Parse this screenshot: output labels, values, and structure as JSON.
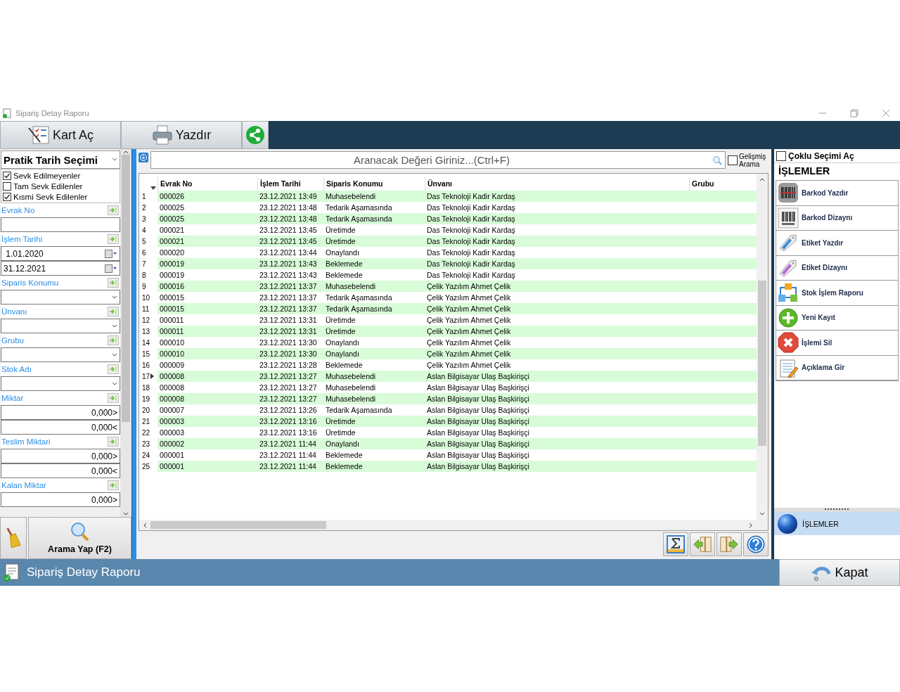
{
  "window": {
    "title": "Sipariş Detay Raporu"
  },
  "toolbar": [
    {
      "label": "Kart Aç",
      "kind": "card"
    },
    {
      "label": "Yazdır",
      "kind": "print"
    },
    {
      "kind": "share"
    }
  ],
  "filters": {
    "date_preset": "Pratik Tarih Seçimi",
    "checks": [
      {
        "label": "Sevk Edilmeyenler",
        "checked": true
      },
      {
        "label": "Tam Sevk Edilenler",
        "checked": false
      },
      {
        "label": "Kısmi Sevk Edilenler",
        "checked": true
      }
    ],
    "fields": [
      {
        "label": "Evrak No",
        "kind": "text"
      },
      {
        "label": "İşlem Tarihi",
        "kind": "dates",
        "values": [
          " 1.01.2020",
          "31.12.2021"
        ]
      },
      {
        "label": "Siparis Konumu",
        "kind": "combo"
      },
      {
        "label": "Ünvanı",
        "kind": "combo"
      },
      {
        "label": "Grubu",
        "kind": "combo"
      },
      {
        "label": "Stok Adı",
        "kind": "combo"
      },
      {
        "label": "Miktar",
        "kind": "range",
        "values": [
          "0,000>",
          "0,000<"
        ]
      },
      {
        "label": "Teslim Miktari",
        "kind": "range",
        "values": [
          "0,000>",
          "0,000<"
        ]
      },
      {
        "label": "Kalan Miktar",
        "kind": "range",
        "values": [
          "0,000>"
        ]
      }
    ],
    "search_button": "Arama Yap (F2)"
  },
  "search": {
    "placeholder": "Aranacak Değeri Giriniz...(Ctrl+F)",
    "advanced": {
      "label": "Gelişmiş Arama",
      "checked": false
    }
  },
  "table": {
    "columns": [
      "Evrak No",
      "İşlem Tarihi",
      "Siparis Konumu",
      "Ünvanı",
      "Grubu"
    ],
    "rows": [
      {
        "no": "1",
        "current": false,
        "cells": [
          "000026",
          "23.12.2021 13:49",
          "Muhasebelendi",
          "Das Teknoloji Kadir Kardaş"
        ]
      },
      {
        "no": "2",
        "current": false,
        "cells": [
          "000025",
          "23.12.2021 13:48",
          "Tedarik Aşamasında",
          "Das Teknoloji Kadir Kardaş"
        ]
      },
      {
        "no": "3",
        "current": false,
        "cells": [
          "000025",
          "23.12.2021 13:48",
          "Tedarik Aşamasında",
          "Das Teknoloji Kadir Kardaş"
        ]
      },
      {
        "no": "4",
        "current": false,
        "cells": [
          "000021",
          "23.12.2021 13:45",
          "Üretimde",
          "Das Teknoloji Kadir Kardaş"
        ]
      },
      {
        "no": "5",
        "current": false,
        "cells": [
          "000021",
          "23.12.2021 13:45",
          "Üretimde",
          "Das Teknoloji Kadir Kardaş"
        ]
      },
      {
        "no": "6",
        "current": false,
        "cells": [
          "000020",
          "23.12.2021 13:44",
          "Onaylandı",
          "Das Teknoloji Kadir Kardaş"
        ]
      },
      {
        "no": "7",
        "current": false,
        "cells": [
          "000019",
          "23.12.2021 13:43",
          "Beklemede",
          "Das Teknoloji Kadir Kardaş"
        ]
      },
      {
        "no": "8",
        "current": false,
        "cells": [
          "000019",
          "23.12.2021 13:43",
          "Beklemede",
          "Das Teknoloji Kadir Kardaş"
        ]
      },
      {
        "no": "9",
        "current": false,
        "cells": [
          "000016",
          "23.12.2021 13:37",
          "Muhasebelendi",
          "Çelik Yazılım Ahmet Çelik"
        ]
      },
      {
        "no": "10",
        "current": false,
        "cells": [
          "000015",
          "23.12.2021 13:37",
          "Tedarik Aşamasında",
          "Çelik Yazılım Ahmet Çelik"
        ]
      },
      {
        "no": "11",
        "current": false,
        "cells": [
          "000015",
          "23.12.2021 13:37",
          "Tedarik Aşamasında",
          "Çelik Yazılım Ahmet Çelik"
        ]
      },
      {
        "no": "12",
        "current": false,
        "cells": [
          "000011",
          "23.12.2021 13:31",
          "Üretimde",
          "Çelik Yazılım Ahmet Çelik"
        ]
      },
      {
        "no": "13",
        "current": false,
        "cells": [
          "000011",
          "23.12.2021 13:31",
          "Üretimde",
          "Çelik Yazılım Ahmet Çelik"
        ]
      },
      {
        "no": "14",
        "current": false,
        "cells": [
          "000010",
          "23.12.2021 13:30",
          "Onaylandı",
          "Çelik Yazılım Ahmet Çelik"
        ]
      },
      {
        "no": "15",
        "current": false,
        "cells": [
          "000010",
          "23.12.2021 13:30",
          "Onaylandı",
          "Çelik Yazılım Ahmet Çelik"
        ]
      },
      {
        "no": "16",
        "current": false,
        "cells": [
          "000009",
          "23.12.2021 13:28",
          "Beklemede",
          "Çelik Yazılım Ahmet Çelik"
        ]
      },
      {
        "no": "17",
        "current": true,
        "cells": [
          "000008",
          "23.12.2021 13:27",
          "Muhasebelendi",
          "Aslan Bilgisayar Ulaş Başkirişçi"
        ]
      },
      {
        "no": "18",
        "current": false,
        "cells": [
          "000008",
          "23.12.2021 13:27",
          "Muhasebelendi",
          "Aslan Bilgisayar Ulaş Başkirişçi"
        ]
      },
      {
        "no": "19",
        "current": false,
        "cells": [
          "000008",
          "23.12.2021 13:27",
          "Muhasebelendi",
          "Aslan Bilgisayar Ulaş Başkirişçi"
        ]
      },
      {
        "no": "20",
        "current": false,
        "cells": [
          "000007",
          "23.12.2021 13:26",
          "Tedarik Aşamasında",
          "Aslan Bilgisayar Ulaş Başkirişçi"
        ]
      },
      {
        "no": "21",
        "current": false,
        "cells": [
          "000003",
          "23.12.2021 13:16",
          "Üretimde",
          "Aslan Bilgisayar Ulaş Başkirişçi"
        ]
      },
      {
        "no": "22",
        "current": false,
        "cells": [
          "000003",
          "23.12.2021 13:16",
          "Üretimde",
          "Aslan Bilgisayar Ulaş Başkirişçi"
        ]
      },
      {
        "no": "23",
        "current": false,
        "cells": [
          "000002",
          "23.12.2021 11:44",
          "Onaylandı",
          "Aslan Bilgisayar Ulaş Başkirişçi"
        ]
      },
      {
        "no": "24",
        "current": false,
        "cells": [
          "000001",
          "23.12.2021 11:44",
          "Beklemede",
          "Aslan Bilgisayar Ulaş Başkirişçi"
        ]
      },
      {
        "no": "25",
        "current": false,
        "cells": [
          "000001",
          "23.12.2021 11:44",
          "Beklemede",
          "Aslan Bilgisayar Ulaş Başkirişçi"
        ]
      }
    ]
  },
  "grid_tools": [
    {
      "kind": "sum"
    },
    {
      "kind": "prev"
    },
    {
      "kind": "next"
    },
    {
      "kind": "help"
    }
  ],
  "actions": {
    "multi_select": {
      "label": "Çoklu Seçimi Aç",
      "checked": false
    },
    "title": "İŞLEMLER",
    "items": [
      {
        "label": "Barkod Yazdır",
        "kind": "barcode-print"
      },
      {
        "label": "Barkod Dizaynı",
        "kind": "barcode-design"
      },
      {
        "label": "Etiket Yazdır",
        "kind": "tag-blue"
      },
      {
        "label": "Etiket Dizaynı",
        "kind": "tag-purple"
      },
      {
        "label": "Stok İşlem Raporu",
        "kind": "cubes"
      },
      {
        "label": "Yeni Kayıt",
        "kind": "add"
      },
      {
        "label": "İşlemi Sil",
        "kind": "delete"
      },
      {
        "label": "Açıklama Gir",
        "kind": "note"
      }
    ]
  },
  "nav_group": {
    "label": "İŞLEMLER",
    "selected": true
  },
  "status_bar": {
    "title": "Sipariş Detay Raporu"
  },
  "close_button": "Kapat"
}
